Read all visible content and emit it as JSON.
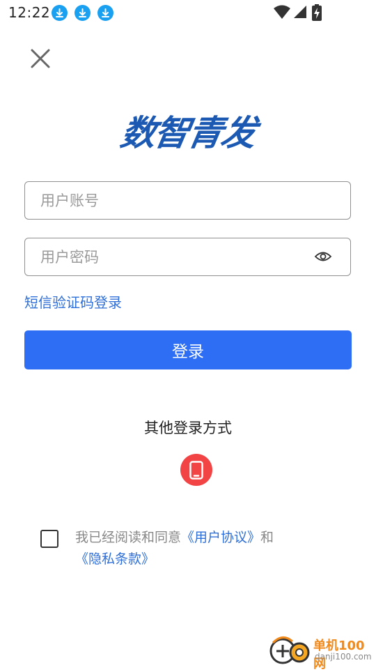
{
  "status_bar": {
    "time": "12:22",
    "download_icons": [
      "download-icon",
      "download-icon",
      "download-icon"
    ],
    "download_icon_color": "#1aa0f0",
    "system_icons": [
      "wifi-icon",
      "signal-icon",
      "battery-charging-icon"
    ]
  },
  "header": {
    "close_icon": "close-icon"
  },
  "logo": {
    "text": "数智青发",
    "color": "#1c59b3"
  },
  "form": {
    "account_placeholder": "用户账号",
    "account_value": "",
    "password_placeholder": "用户密码",
    "password_value": "",
    "password_toggle_icon": "eye-icon",
    "sms_login_label": "短信验证码登录",
    "login_button_label": "登录",
    "accent_color": "#2d6ef5"
  },
  "other_login": {
    "title": "其他登录方式",
    "phone_icon": "phone-icon",
    "phone_button_color": "#f24444"
  },
  "agreement": {
    "checked": false,
    "prefix": "我已经阅读和同意",
    "user_agreement_label": "《用户协议》",
    "and_text": "和",
    "privacy_label": "《隐私条款》"
  },
  "watermark": {
    "brand": "单机100网",
    "domain": "danji100.com"
  }
}
